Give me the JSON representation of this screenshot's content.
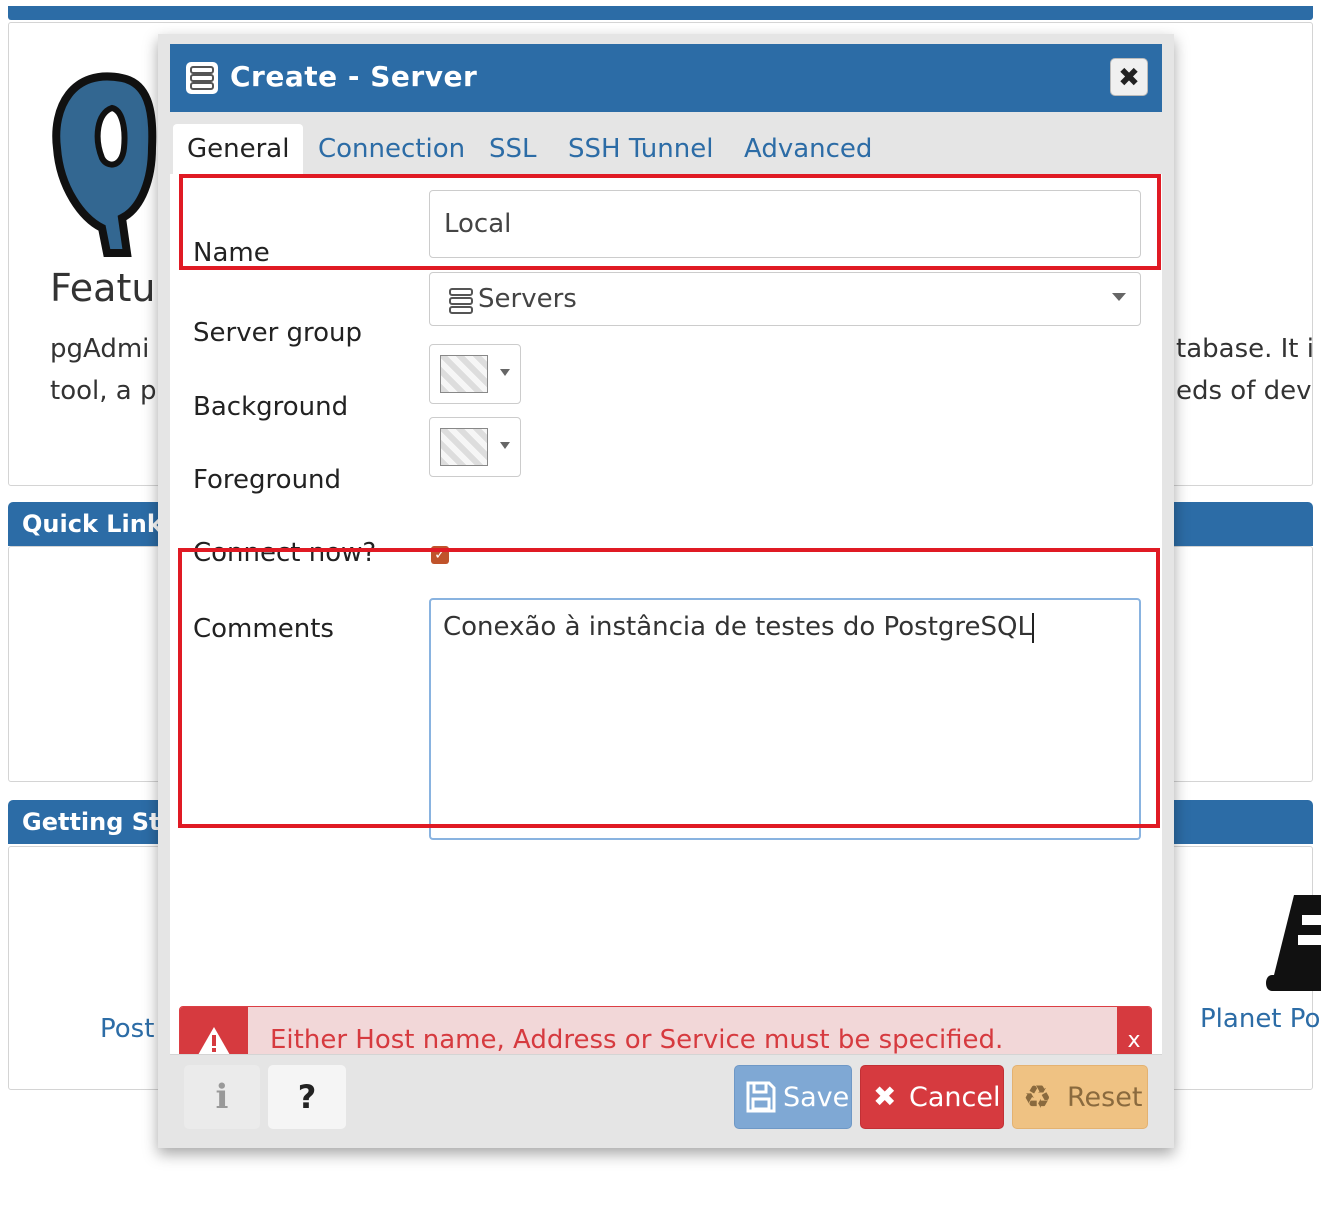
{
  "background": {
    "features_title": "Featu",
    "features_line1_left": "pgAdmi",
    "features_line1_right": "tabase. It i",
    "features_line2_left": "tool, a pr",
    "features_line2_right": "eds of dev",
    "quick_links": "Quick Link",
    "getting_started": "Getting Sta",
    "link_left": "Post",
    "link_right": "Planet Po"
  },
  "dialog": {
    "title": "Create - Server",
    "tabs": [
      "General",
      "Connection",
      "SSL",
      "SSH Tunnel",
      "Advanced"
    ],
    "fields": {
      "name_label": "Name",
      "name_value": "Local",
      "server_group_label": "Server group",
      "server_group_value": "Servers",
      "background_label": "Background",
      "foreground_label": "Foreground",
      "connect_now_label": "Connect now?",
      "comments_label": "Comments",
      "comments_value": "Conexão à instância de testes do PostgreSQL"
    },
    "alert": {
      "message": "Either Host name, Address or Service must be specified.",
      "close": "x"
    },
    "footer": {
      "info": "i",
      "help": "?",
      "save": "Save",
      "cancel": "Cancel",
      "reset": "Reset"
    }
  },
  "colors": {
    "primary": "#2c6ca6",
    "danger": "#d63a3f",
    "highlight": "#e01a24",
    "save_btn": "#7fa8d4",
    "reset_btn": "#efc283",
    "checkbox": "#c0532b"
  }
}
